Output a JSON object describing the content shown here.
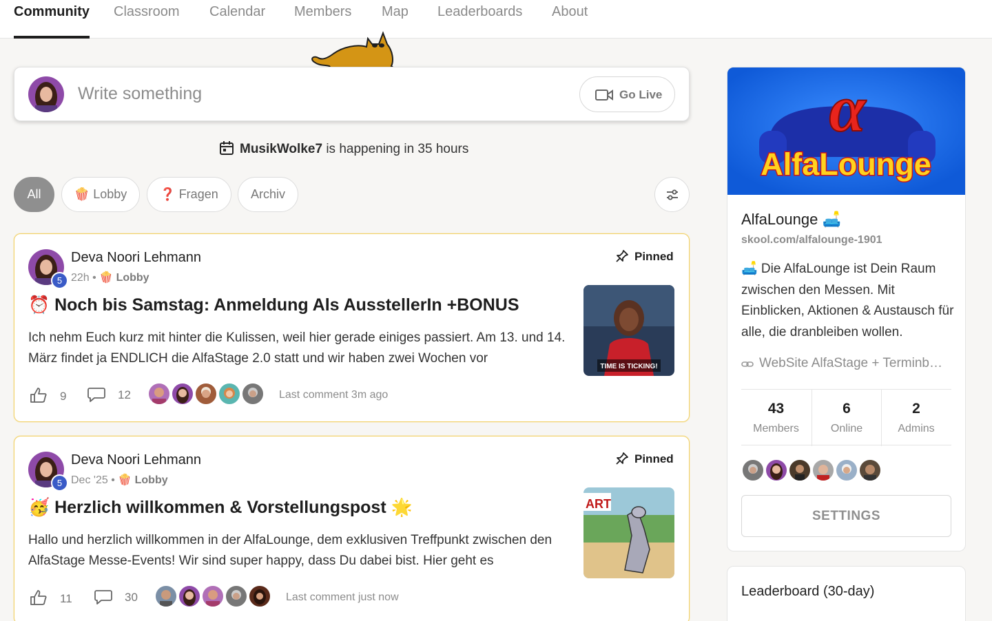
{
  "nav": {
    "tabs": [
      {
        "label": "Community",
        "active": true
      },
      {
        "label": "Classroom",
        "active": false
      },
      {
        "label": "Calendar",
        "active": false
      },
      {
        "label": "Members",
        "active": false
      },
      {
        "label": "Map",
        "active": false
      },
      {
        "label": "Leaderboards",
        "active": false
      },
      {
        "label": "About",
        "active": false
      }
    ]
  },
  "composer": {
    "placeholder": "Write something",
    "golive_label": "Go Live"
  },
  "event": {
    "name": "MusikWolke7",
    "text": "is happening in 35 hours"
  },
  "filters": {
    "chips": [
      {
        "label": "All",
        "icon": "",
        "active": true
      },
      {
        "label": "Lobby",
        "icon": "🍿",
        "active": false
      },
      {
        "label": "Fragen",
        "icon": "❓",
        "active": false
      },
      {
        "label": "Archiv",
        "icon": "",
        "active": false
      }
    ]
  },
  "posts": [
    {
      "author": "Deva Noori Lehmann",
      "level": "5",
      "time": "22h",
      "category_icon": "🍿",
      "category": "Lobby",
      "pinned_label": "Pinned",
      "title_icon": "⏰",
      "title": "Noch bis Samstag: Anmeldung Als AusstellerIn +BONUS",
      "excerpt": "Ich nehm Euch kurz mit hinter die Kulissen, weil hier gerade einiges passiert. Am 13. und 14. März findet ja ENDLICH die AlfaStage 2.0 statt und wir haben zwei Wochen vor",
      "thumb_caption": "TIME IS TICKING!",
      "likes": "9",
      "comments": "12",
      "last_comment": "Last comment 3m ago"
    },
    {
      "author": "Deva Noori Lehmann",
      "level": "5",
      "time": "Dec '25",
      "category_icon": "🍿",
      "category": "Lobby",
      "pinned_label": "Pinned",
      "title_icon": "🥳",
      "title": "Herzlich willkommen & Vorstellungspost",
      "title_suffix": "🌟",
      "excerpt": "Hallo und herzlich willkommen in der AlfaLounge, dem exklusiven Treffpunkt zwischen den AlfaStage Messe-Events! Wir sind super happy, dass Du dabei bist. Hier geht es",
      "thumb_caption": "ART",
      "likes": "11",
      "comments": "30",
      "last_comment": "Last comment just now"
    }
  ],
  "group": {
    "banner_symbol": "α",
    "banner_text": "AlfaLounge",
    "name": "AlfaLounge",
    "name_icon": "🛋️",
    "url": "skool.com/alfalounge-1901",
    "description": "🛋️ Die AlfaLounge ist Dein Raum zwischen den Messen. Mit Einblicken, Aktionen & Austausch für alle, die dranbleiben wollen.",
    "link": "WebSite AlfaStage + Terminb…",
    "stats": [
      {
        "num": "43",
        "label": "Members"
      },
      {
        "num": "6",
        "label": "Online"
      },
      {
        "num": "2",
        "label": "Admins"
      }
    ],
    "settings_label": "SETTINGS"
  },
  "leaderboard": {
    "title": "Leaderboard (30-day)"
  },
  "colors": {
    "accent_yellow": "#f2d26a",
    "badge_blue": "#3a5bc7",
    "banner_blue": "#1770f0"
  }
}
